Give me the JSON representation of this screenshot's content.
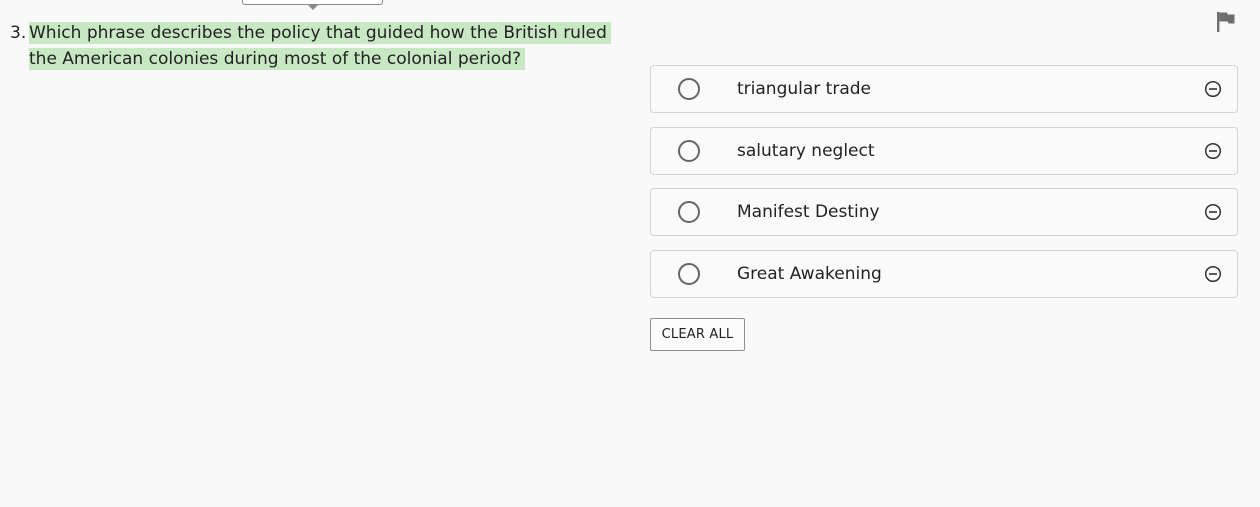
{
  "question": {
    "number": "3.",
    "text": "Which phrase describes the policy that guided how the British ruled the American colonies during most of the colonial period?"
  },
  "flag": {
    "icon": "flag-icon"
  },
  "options": [
    {
      "label": "triangular trade",
      "selected": false,
      "icon": "eliminate-icon"
    },
    {
      "label": "salutary neglect",
      "selected": false,
      "icon": "eliminate-icon"
    },
    {
      "label": "Manifest Destiny",
      "selected": false,
      "icon": "eliminate-icon"
    },
    {
      "label": "Great Awakening",
      "selected": false,
      "icon": "eliminate-icon"
    }
  ],
  "clear_all_label": "CLEAR ALL",
  "colors": {
    "highlight": "#c8e8c4",
    "background": "#f9f9f9",
    "border": "#d4d4d4"
  }
}
